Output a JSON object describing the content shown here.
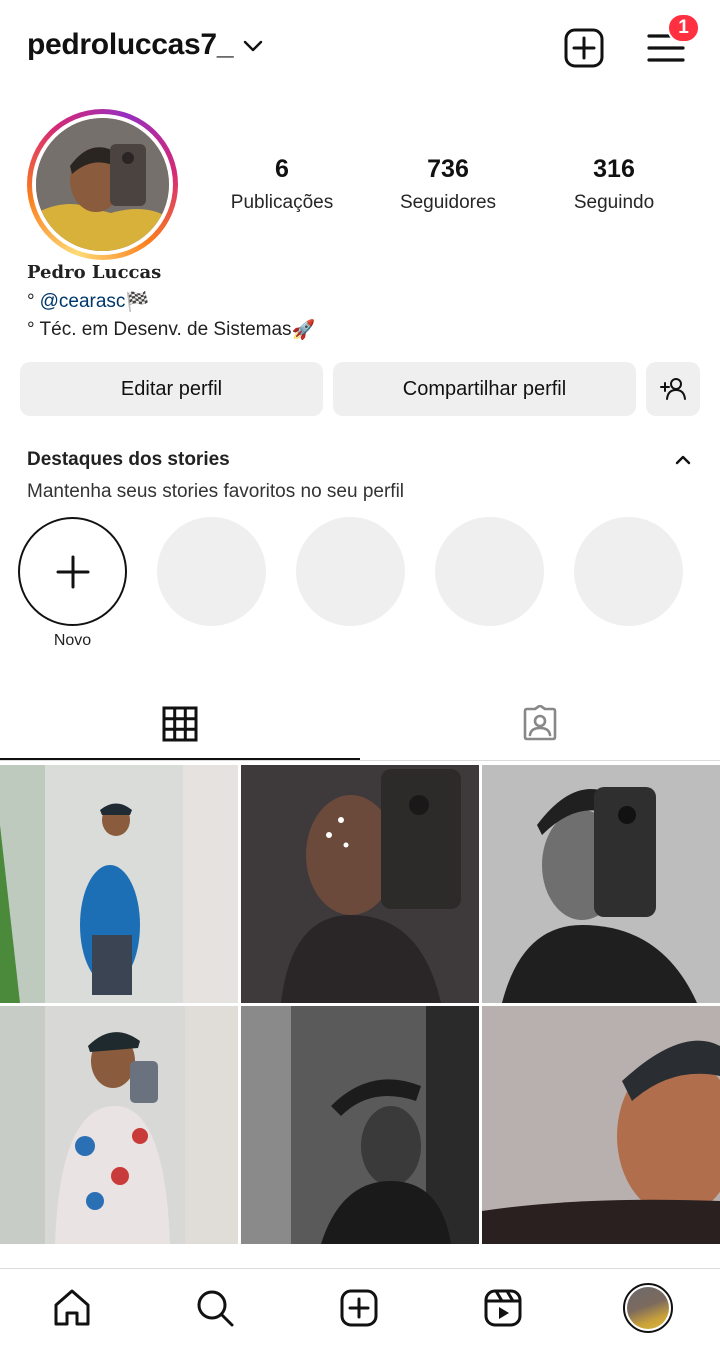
{
  "header": {
    "username": "pedroluccas7_",
    "notification_count": "1"
  },
  "profile": {
    "stats": [
      {
        "value": "6",
        "label": "Publicações"
      },
      {
        "value": "736",
        "label": "Seguidores"
      },
      {
        "value": "316",
        "label": "Seguindo"
      }
    ],
    "full_name": "Pedro Luccas",
    "bio_line1_prefix": "°",
    "bio_line1_mention": "@cearasc",
    "bio_line1_emoji": "🏁",
    "bio_line2": "° Téc. em Desenv. de Sistemas",
    "bio_line2_emoji": "🚀"
  },
  "actions": {
    "edit_label": "Editar perfil",
    "share_label": "Compartilhar perfil"
  },
  "highlights": {
    "title": "Destaques dos stories",
    "subtitle": "Mantenha seus stories favoritos no seu perfil",
    "new_label": "Novo"
  },
  "tabs": [
    "grid-icon",
    "tagged-icon"
  ],
  "bottom_nav": [
    "home-icon",
    "search-icon",
    "create-icon",
    "reels-icon",
    "profile-avatar"
  ],
  "colors": {
    "badge": "#ff3040",
    "mention": "#00376b",
    "button_bg": "#efefef",
    "placeholder": "#efefef"
  }
}
